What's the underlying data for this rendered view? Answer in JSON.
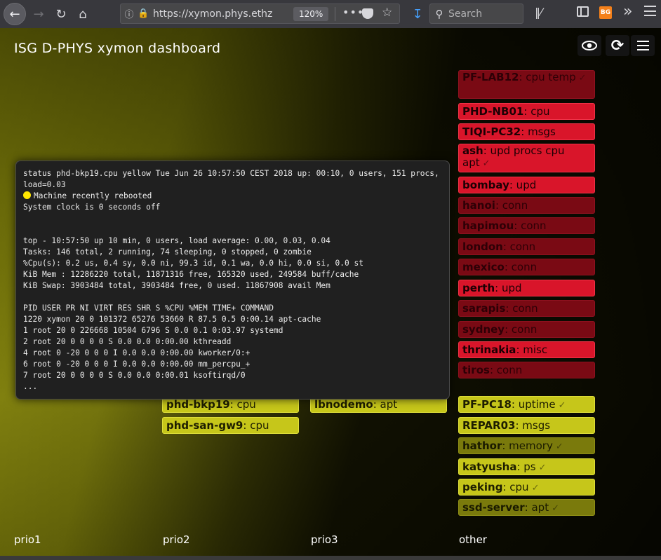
{
  "browser": {
    "url": "https://xymon.phys.ethz",
    "zoom": "120%",
    "search_placeholder": "Search",
    "bg_badge": "BG"
  },
  "dashboard": {
    "title": "ISG D-PHYS xymon dashboard",
    "columns": [
      "prio1",
      "prio2",
      "prio3",
      "other"
    ],
    "tiles": {
      "pf_lab12": {
        "host": "PF-LAB12",
        "svc": ": cpu temp"
      },
      "phd_nb01": {
        "host": "PHD-NB01",
        "svc": ": cpu"
      },
      "tiqi_pc32": {
        "host": "TIQI-PC32",
        "svc": ": msgs"
      },
      "ash": {
        "host": "ash",
        "svc": ": upd procs cpu apt"
      },
      "bombay": {
        "host": "bombay",
        "svc": ": upd"
      },
      "hanoi": {
        "host": "hanoi",
        "svc": ": conn"
      },
      "hapimou": {
        "host": "hapimou",
        "svc": ": conn"
      },
      "london": {
        "host": "london",
        "svc": ": conn"
      },
      "mexico": {
        "host": "mexico",
        "svc": ": conn"
      },
      "perth": {
        "host": "perth",
        "svc": ": upd"
      },
      "sarapis": {
        "host": "sarapis",
        "svc": ": conn"
      },
      "sydney": {
        "host": "sydney",
        "svc": ": conn"
      },
      "thrinakia": {
        "host": "thrinakia",
        "svc": ": misc"
      },
      "tiros": {
        "host": "tiros",
        "svc": ": conn"
      },
      "phd_bkp19": {
        "host": "phd-bkp19",
        "svc": ": cpu"
      },
      "phd_san_gw9": {
        "host": "phd-san-gw9",
        "svc": ": cpu"
      },
      "lbnodemo": {
        "host": "lbnodemo",
        "svc": ": apt"
      },
      "pf_pc18": {
        "host": "PF-PC18",
        "svc": ": uptime"
      },
      "repar03": {
        "host": "REPAR03",
        "svc": ": msgs"
      },
      "hathor": {
        "host": "hathor",
        "svc": ": memory"
      },
      "katyusha": {
        "host": "katyusha",
        "svc": ": ps"
      },
      "peking": {
        "host": "peking",
        "svc": ": cpu"
      },
      "ssd_server": {
        "host": "ssd-server",
        "svc": ": apt"
      }
    },
    "popup": {
      "status_line": "status phd-bkp19.cpu yellow Tue Jun 26 10:57:50 CEST 2018 up: 00:10, 0 users, 151 procs, load=0.03",
      "rebooted": "Machine recently rebooted",
      "clock": "System clock is 0 seconds off",
      "top": "top - 10:57:50 up 10 min, 0 users, load average: 0.00, 0.03, 0.04",
      "tasks": "Tasks: 146 total, 2 running, 74 sleeping, 0 stopped, 0 zombie",
      "cpu": "%Cpu(s): 0.2 us, 0.4 sy, 0.0 ni, 99.3 id, 0.1 wa, 0.0 hi, 0.0 si, 0.0 st",
      "mem": "KiB Mem : 12286220 total, 11871316 free, 165320 used, 249584 buff/cache",
      "swap": "KiB Swap: 3903484 total, 3903484 free, 0 used. 11867908 avail Mem",
      "header": "PID USER PR NI VIRT RES SHR S %CPU %MEM TIME+ COMMAND",
      "rows": [
        "1220 xymon 20 0 101372 65276 53660 R 87.5 0.5 0:00.14 apt-cache",
        "1 root 20 0 226668 10504 6796 S 0.0 0.1 0:03.97 systemd",
        "2 root 20 0 0 0 0 S 0.0 0.0 0:00.00 kthreadd",
        "4 root 0 -20 0 0 0 I 0.0 0.0 0:00.00 kworker/0:+",
        "6 root 0 -20 0 0 0 I 0.0 0.0 0:00.00 mm_percpu_+",
        "7 root 20 0 0 0 0 S 0.0 0.0 0:00.01 ksoftirqd/0"
      ],
      "ellipsis": "..."
    }
  }
}
